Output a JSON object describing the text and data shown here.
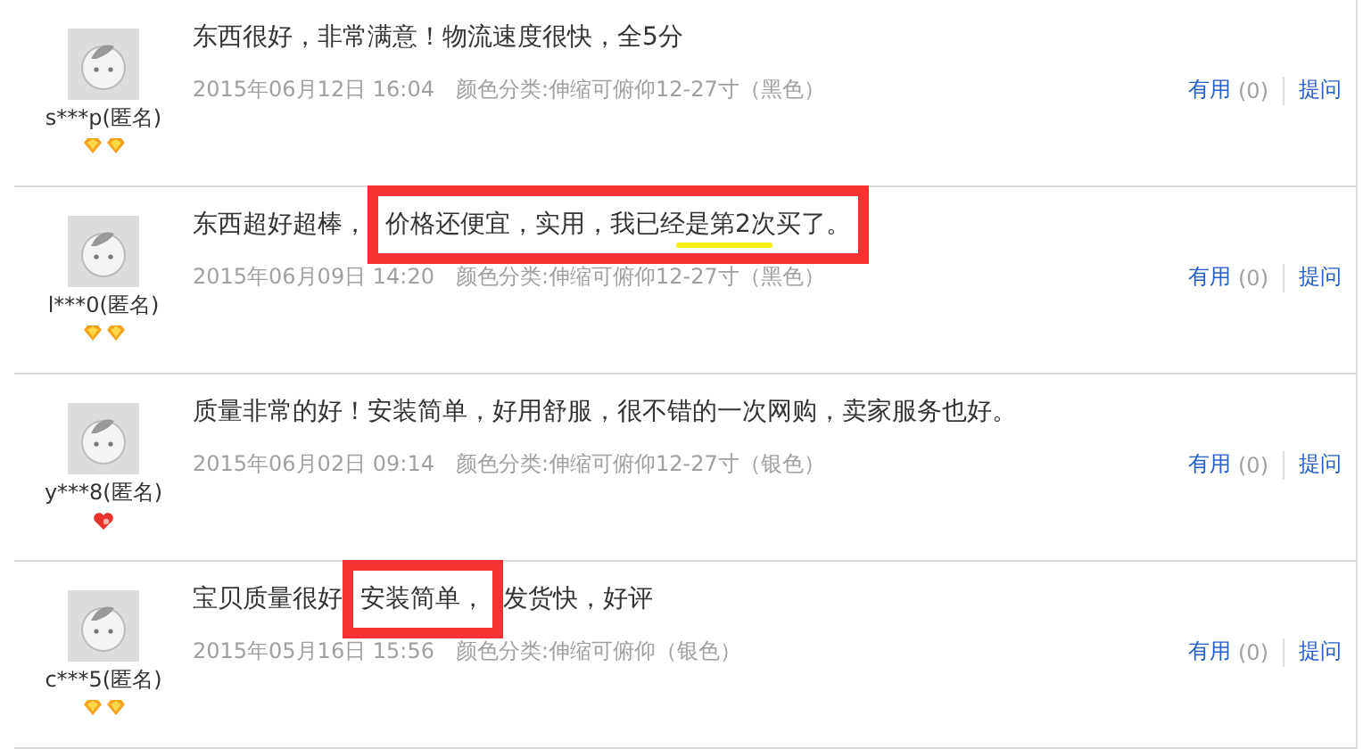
{
  "reviews": [
    {
      "user": "s***p(匿名)",
      "rank_icons": [
        {
          "kind": "diamond"
        },
        {
          "kind": "diamond"
        }
      ],
      "content": [
        {
          "text": "东西很好，非常满意！物流速度很快，全5分",
          "highlighted": false
        }
      ],
      "date": "2015年06月12日 16:04",
      "spec": "颜色分类:伸缩可俯仰12-27寸（黑色）",
      "useful": "有用",
      "useful_count": "(0)",
      "ask": "提问"
    },
    {
      "user": "l***0(匿名)",
      "rank_icons": [
        {
          "kind": "diamond"
        },
        {
          "kind": "diamond"
        }
      ],
      "content": [
        {
          "text": "东西超好超棒，",
          "highlighted": false
        },
        {
          "text": "价格还便宜，实用，我已经是第2次买了。",
          "highlighted": true,
          "underlined": true
        }
      ],
      "date": "2015年06月09日 14:20",
      "spec": "颜色分类:伸缩可俯仰12-27寸（黑色）",
      "useful": "有用",
      "useful_count": "(0)",
      "ask": "提问"
    },
    {
      "user": "y***8(匿名)",
      "rank_icons": [
        {
          "kind": "heart"
        }
      ],
      "content": [
        {
          "text": "质量非常的好！安装简单，好用舒服，很不错的一次网购，卖家服务也好。",
          "highlighted": false
        }
      ],
      "date": "2015年06月02日 09:14",
      "spec": "颜色分类:伸缩可俯仰12-27寸（银色）",
      "useful": "有用",
      "useful_count": "(0)",
      "ask": "提问"
    },
    {
      "user": "c***5(匿名)",
      "rank_icons": [
        {
          "kind": "diamond"
        },
        {
          "kind": "diamond"
        }
      ],
      "content": [
        {
          "text": "宝贝质量很好",
          "highlighted": false
        },
        {
          "text": "安装简单，",
          "highlighted": true,
          "underlined": false
        },
        {
          "text": "发货快，好评",
          "highlighted": false
        }
      ],
      "date": "2015年05月16日 15:56",
      "spec": "颜色分类:伸缩可俯仰（银色）",
      "useful": "有用",
      "useful_count": "(0)",
      "ask": "提问"
    }
  ]
}
